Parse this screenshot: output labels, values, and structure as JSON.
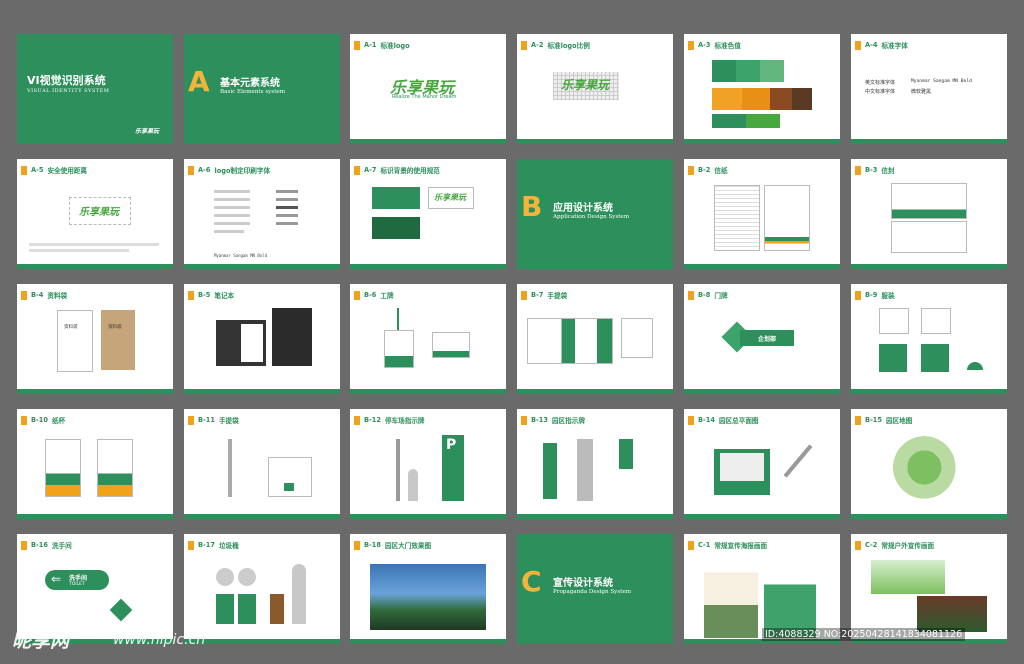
{
  "cover": {
    "title": "VI视觉识别系统",
    "subtitle": "VISUAL IDENTITY SYSTEM"
  },
  "brand": {
    "logo_text": "乐享果玩",
    "slogan": "Realize The Manor Dream"
  },
  "sections": {
    "a": {
      "letter": "A",
      "cn": "基本元素系统",
      "en": "Basic Elements system"
    },
    "b": {
      "letter": "B",
      "cn": "应用设计系统",
      "en": "Application Design System"
    },
    "c": {
      "letter": "C",
      "cn": "宣传设计系统",
      "en": "Propaganda Design System"
    }
  },
  "pages": [
    {
      "code": "A-1",
      "name": "标准logo"
    },
    {
      "code": "A-2",
      "name": "标准logo比例"
    },
    {
      "code": "A-3",
      "name": "标准色值"
    },
    {
      "code": "A-4",
      "name": "标准字体"
    },
    {
      "code": "A-5",
      "name": "安全使用距离"
    },
    {
      "code": "A-6",
      "name": "logo制定印刷字体"
    },
    {
      "code": "A-7",
      "name": "标识背景的使用规范"
    },
    {
      "code": "B-2",
      "name": "信纸"
    },
    {
      "code": "B-3",
      "name": "信封"
    },
    {
      "code": "B-4",
      "name": "资料袋"
    },
    {
      "code": "B-5",
      "name": "笔记本"
    },
    {
      "code": "B-6",
      "name": "工牌"
    },
    {
      "code": "B-7",
      "name": "手提袋"
    },
    {
      "code": "B-8",
      "name": "门牌"
    },
    {
      "code": "B-9",
      "name": "服装"
    },
    {
      "code": "B-10",
      "name": "纸杯"
    },
    {
      "code": "B-11",
      "name": "手提袋"
    },
    {
      "code": "B-12",
      "name": "停车场指示牌"
    },
    {
      "code": "B-13",
      "name": "园区指示牌"
    },
    {
      "code": "B-14",
      "name": "园区总平面图"
    },
    {
      "code": "B-15",
      "name": "园区地图"
    },
    {
      "code": "B-16",
      "name": "洗手间"
    },
    {
      "code": "B-17",
      "name": "垃圾桶"
    },
    {
      "code": "B-18",
      "name": "园区大门效果图"
    },
    {
      "code": "C-1",
      "name": "常规宣传海报画面"
    },
    {
      "code": "C-2",
      "name": "常规户外宣传画面"
    }
  ],
  "fonts_page": {
    "en_label": "英文标准字体",
    "en_value": "Myanmar Sangam MN Bold",
    "cn_label": "中文标准字体",
    "cn_value": "微软雅黑"
  },
  "door_sign": {
    "label": "企划部"
  },
  "folder": {
    "label": "资料袋"
  },
  "restroom": {
    "cn": "洗手间",
    "en": "TOILET"
  },
  "watermark": {
    "left": "昵享网",
    "url": "www.nipic.cn",
    "right": "ID:4088329 NO:20250428141834081126"
  },
  "colors": {
    "brand_green": "#2d8f5c",
    "accent_orange": "#f1a21b",
    "background": "#6a6a6a"
  }
}
